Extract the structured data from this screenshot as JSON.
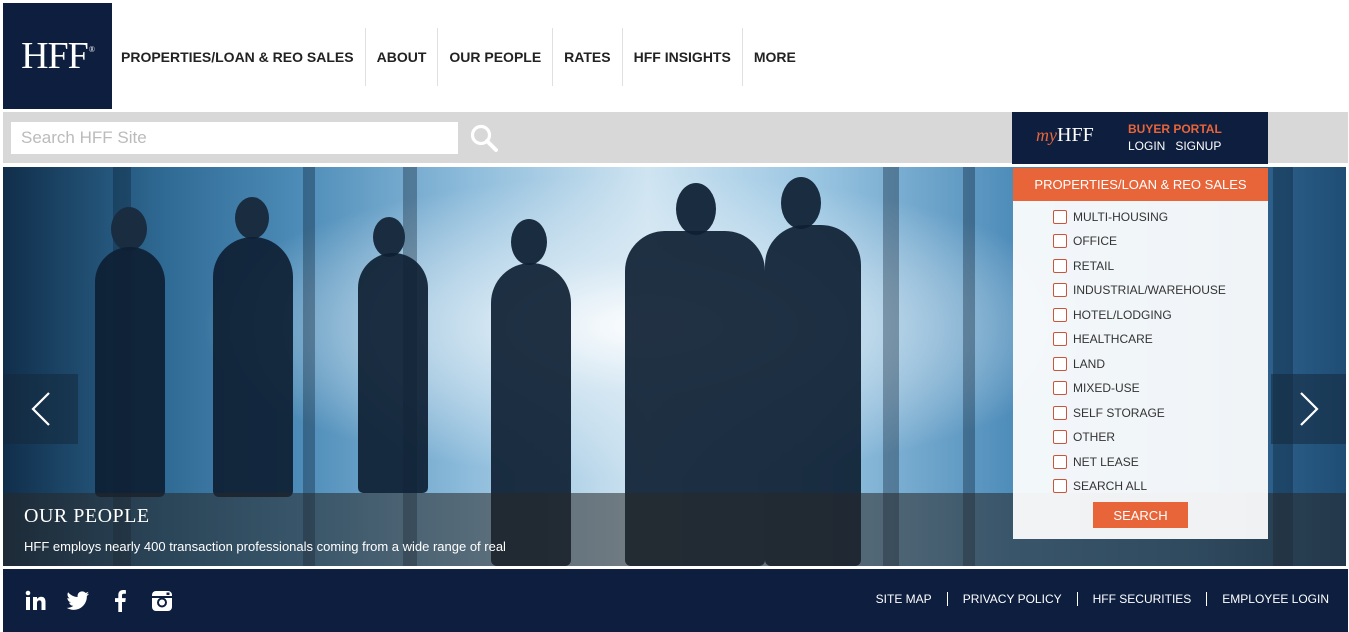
{
  "brand": {
    "logo_text": "HFF",
    "logo_mark": "®"
  },
  "nav": {
    "items": [
      {
        "label": "PROPERTIES/LOAN & REO SALES"
      },
      {
        "label": "ABOUT"
      },
      {
        "label": "OUR PEOPLE"
      },
      {
        "label": "RATES"
      },
      {
        "label": "HFF INSIGHTS"
      },
      {
        "label": "MORE"
      }
    ]
  },
  "search": {
    "placeholder": "Search HFF Site",
    "value": ""
  },
  "portal": {
    "my": "my",
    "brand": "HFF",
    "title": "BUYER PORTAL",
    "login": "LOGIN",
    "signup": "SIGNUP"
  },
  "hero": {
    "title": "OUR PEOPLE",
    "text": "HFF employs nearly 400 transaction professionals coming from a wide range of real"
  },
  "filter": {
    "title": "PROPERTIES/LOAN & REO SALES",
    "options": [
      {
        "label": "MULTI-HOUSING"
      },
      {
        "label": "OFFICE"
      },
      {
        "label": "RETAIL"
      },
      {
        "label": "INDUSTRIAL/WAREHOUSE"
      },
      {
        "label": "HOTEL/LODGING"
      },
      {
        "label": "HEALTHCARE"
      },
      {
        "label": "LAND"
      },
      {
        "label": "MIXED-USE"
      },
      {
        "label": "SELF STORAGE"
      },
      {
        "label": "OTHER"
      },
      {
        "label": "NET LEASE"
      },
      {
        "label": "SEARCH ALL"
      }
    ],
    "search_label": "SEARCH"
  },
  "footer": {
    "links": [
      {
        "label": "SITE MAP"
      },
      {
        "label": "PRIVACY POLICY"
      },
      {
        "label": "HFF SECURITIES"
      },
      {
        "label": "EMPLOYEE LOGIN"
      }
    ]
  },
  "colors": {
    "navy": "#0d1e3f",
    "accent": "#e8653a",
    "strip": "#d8d8d8"
  }
}
